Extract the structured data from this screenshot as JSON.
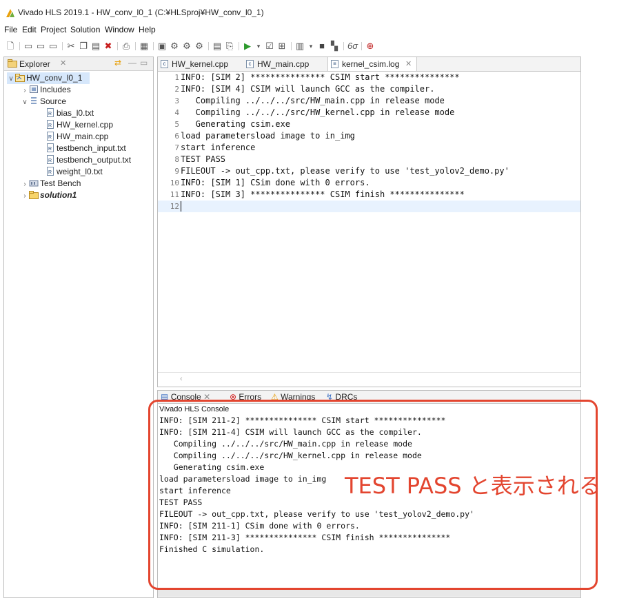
{
  "window": {
    "title": "Vivado HLS 2019.1 - HW_conv_l0_1 (C:¥HLSproj¥HW_conv_l0_1)"
  },
  "menu": [
    "File",
    "Edit",
    "Project",
    "Solution",
    "Window",
    "Help"
  ],
  "explorer": {
    "title": "Explorer",
    "tree": [
      {
        "label": "HW_conv_l0_1",
        "level": 0,
        "expanded": true,
        "icon": "project-icon",
        "selected": true
      },
      {
        "label": "Includes",
        "level": 1,
        "expanded": false,
        "icon": "includes-icon"
      },
      {
        "label": "Source",
        "level": 1,
        "expanded": true,
        "icon": "source-folder-icon"
      },
      {
        "label": "bias_l0.txt",
        "level": 2,
        "icon": "file-icon"
      },
      {
        "label": "HW_kernel.cpp",
        "level": 2,
        "icon": "file-icon"
      },
      {
        "label": "HW_main.cpp",
        "level": 2,
        "icon": "file-icon"
      },
      {
        "label": "testbench_input.txt",
        "level": 2,
        "icon": "file-icon"
      },
      {
        "label": "testbench_output.txt",
        "level": 2,
        "icon": "file-icon"
      },
      {
        "label": "weight_l0.txt",
        "level": 2,
        "icon": "file-icon"
      },
      {
        "label": "Test Bench",
        "level": 1,
        "expanded": false,
        "icon": "testbench-icon"
      },
      {
        "label": "solution1",
        "level": 1,
        "expanded": false,
        "icon": "solution-folder-icon",
        "bold": true
      }
    ]
  },
  "editor": {
    "tabs": [
      {
        "label": "HW_kernel.cpp",
        "active": false
      },
      {
        "label": "HW_main.cpp",
        "active": false
      },
      {
        "label": "kernel_csim.log",
        "active": true
      }
    ],
    "lines": [
      "INFO: [SIM 2] *************** CSIM start ***************",
      "INFO: [SIM 4] CSIM will launch GCC as the compiler.",
      "   Compiling ../../../src/HW_main.cpp in release mode",
      "   Compiling ../../../src/HW_kernel.cpp in release mode",
      "   Generating csim.exe",
      "load parametersload image to in_img",
      "start inference",
      "TEST PASS",
      "FILEOUT -> out_cpp.txt, please verify to use 'test_yolov2_demo.py'",
      "INFO: [SIM 1] CSim done with 0 errors.",
      "INFO: [SIM 3] *************** CSIM finish ***************",
      ""
    ]
  },
  "console": {
    "tabs": [
      "Console",
      "Errors",
      "Warnings",
      "DRCs"
    ],
    "header": "Vivado HLS Console",
    "lines": [
      "INFO: [SIM 211-2] *************** CSIM start ***************",
      "INFO: [SIM 211-4] CSIM will launch GCC as the compiler.",
      "   Compiling ../../../src/HW_main.cpp in release mode",
      "   Compiling ../../../src/HW_kernel.cpp in release mode",
      "   Generating csim.exe",
      "load parametersload image to in_img",
      "start inference",
      "TEST PASS",
      "FILEOUT -> out_cpp.txt, please verify to use 'test_yolov2_demo.py'",
      "INFO: [SIM 211-1] CSim done with 0 errors.",
      "INFO: [SIM 211-3] *************** CSIM finish ***************",
      "Finished C simulation."
    ]
  },
  "annotation": {
    "text": "TEST PASS と表示される",
    "color": "#e3452f"
  }
}
